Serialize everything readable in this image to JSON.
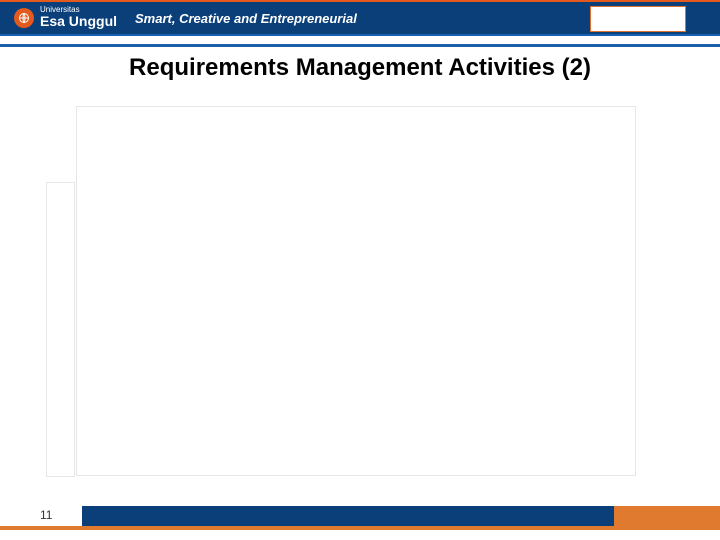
{
  "header": {
    "university_superscript": "Universitas",
    "university_name": "Esa Unggul",
    "tagline": "Smart, Creative and Entrepreneurial"
  },
  "slide": {
    "title": "Requirements Management Activities (2)"
  },
  "footer": {
    "page_number": "11"
  }
}
